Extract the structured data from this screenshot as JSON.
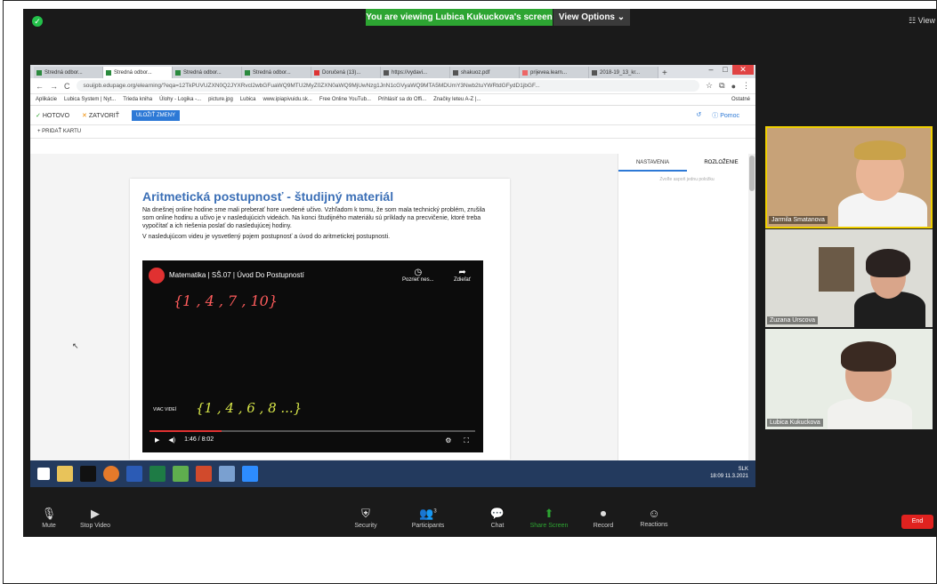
{
  "zoom": {
    "banner": "You are viewing Lubica Kukuckova's screen",
    "view_options": "View Options ⌄",
    "view_button": "☷ View",
    "end_button": "End",
    "toolbar": [
      {
        "label": "Mute",
        "icon": "mic-icon"
      },
      {
        "label": "Stop Video",
        "icon": "video-icon"
      },
      {
        "label": "Security",
        "icon": "shield-icon"
      },
      {
        "label": "Participants",
        "icon": "participants-icon",
        "count": "3"
      },
      {
        "label": "Chat",
        "icon": "chat-icon"
      },
      {
        "label": "Share Screen",
        "icon": "share-screen-icon"
      },
      {
        "label": "Record",
        "icon": "record-icon"
      },
      {
        "label": "Reactions",
        "icon": "reactions-icon"
      }
    ],
    "participants": [
      {
        "name": "Jarmila Smatanova"
      },
      {
        "name": "Zuzana Urscova"
      },
      {
        "name": "Lubica Kukuckova"
      }
    ]
  },
  "browser": {
    "tabs": [
      "Stredná odbor...",
      "Stredná odbor...",
      "Stredná odbor...",
      "Stredná odbor...",
      "Doručená (13)...",
      "https://vydavi...",
      "shakuoz.pdf",
      "prijevea.learn...",
      "2018-19_13_kr..."
    ],
    "url": "souijpb.edupage.org/elearning/?eqa=12TkPUVUZXN0Q2JYXRvcl2wbGFuaWQ9MTU2MyZ0ZXN0aWQ9MjUwNzg1JnN1cGVyaWQ9MTA5MDUmY3Nwb2tuYWRtdGFydD1jbGF...",
    "bookmarks": [
      "Aplikácie",
      "Lubica System | Nyt...",
      "Trieda kniha",
      "Úlohy - Logika -...",
      "picture.jpg",
      "Lubica",
      "www.ipiapivuidu.sk...",
      "Free Online YouTub...",
      "Prihlásiť sa do Offi...",
      "Značky leteu A-Z |...",
      "Ostatné"
    ]
  },
  "edupage": {
    "done": "HOTOVO",
    "close": "ZATVORIŤ",
    "save": "ULOŽIŤ ZMENY",
    "help": "Pomoc",
    "add_card": "+ PRIDAŤ KARTU",
    "doc_title": "Aritmetická postupnosť - študijný materiál",
    "para1": "Na dnešnej online hodine sme mali preberať hore uvedené učivo. Vzhľadom k tomu, že som mala technický problém, zrušila som online hodinu a učivo je v nasledujúcich videách. Na konci študijného materiálu sú príklady na precvičenie, ktoré treba vypočítať a ich riešenia poslať do nasledujúcej hodiny.",
    "para2": "V nasledujúcom videu je vysvetlený pojem postupnosť a úvod do aritmetickej postupnosti.",
    "panel_tab1": "NASTAVENIA",
    "panel_tab2": "ROZLOŽENIE",
    "panel_hint": "Zvoľte aspoň jednu položku"
  },
  "video": {
    "title": "Matematika | SŠ.07 | Úvod Do Postupností",
    "watch_later": "Pozrieť nes...",
    "share": "Zdieľať",
    "more_videos": "VIAC VIDEÍ",
    "time": "1:46 / 8:02",
    "board_seq": "{1 , 4 , 7 , 10}",
    "board_seq2": "{1 , 4 , 6 , 8 ...}",
    "progress": 0.22
  },
  "taskbar": {
    "lang": "SLK",
    "time": "18:09",
    "date": "11.3.2021"
  }
}
